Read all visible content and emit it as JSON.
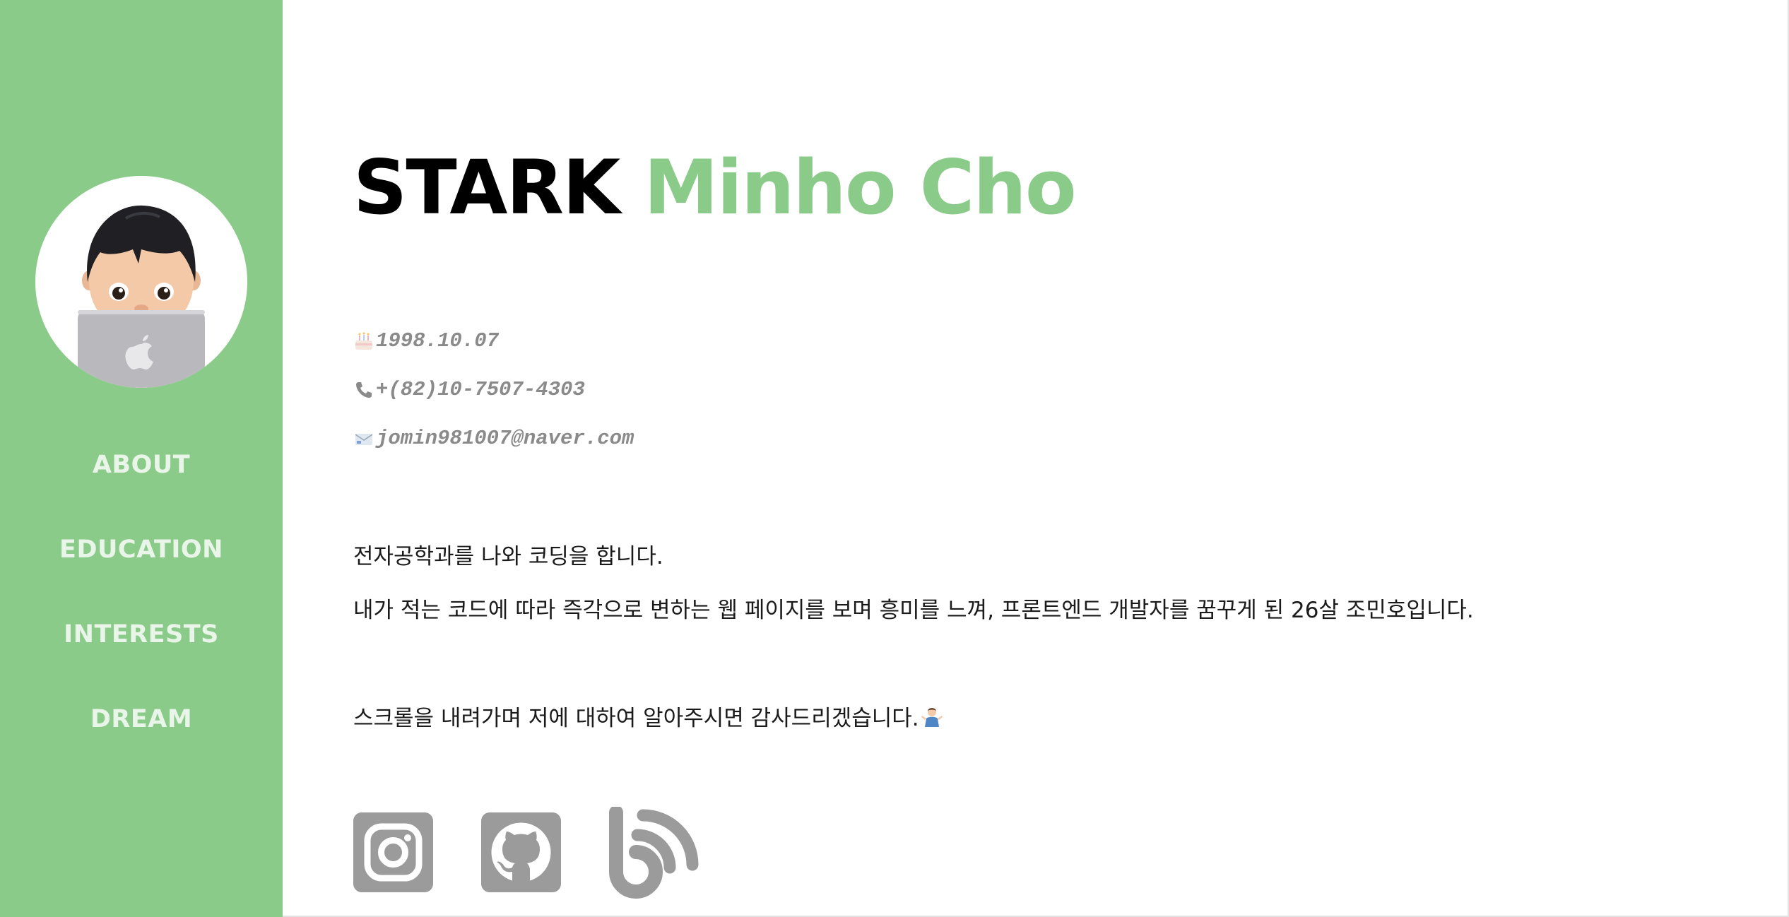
{
  "sidebar": {
    "nav": [
      {
        "label": "ABOUT"
      },
      {
        "label": "EDUCATION"
      },
      {
        "label": "INTERESTS"
      },
      {
        "label": "DREAM"
      }
    ]
  },
  "header": {
    "title_prefix": "STARK",
    "title_name": "Minho Cho"
  },
  "contact": {
    "birthday": "1998.10.07",
    "phone": "+(82)10-7507-4303",
    "email": "jomin981007@naver.com"
  },
  "intro": {
    "line1": "전자공학과를 나와 코딩을 합니다.",
    "line2": "내가 적는 코드에 따라 즉각으로 변하는 웹 페이지를 보며 흥미를 느껴, 프론트엔드 개발자를 꿈꾸게 된 26살 조민호입니다.",
    "line3": "스크롤을 내려가며 저에 대하여 알아주시면 감사드리겠습니다."
  },
  "colors": {
    "accent": "#8bcb89",
    "icon_gray": "#9b9b9b"
  },
  "icons": {
    "birthday": "cake-icon",
    "phone": "phone-icon",
    "email": "envelope-icon",
    "shrug": "person-shrugging-icon",
    "social": [
      "instagram-icon",
      "github-icon",
      "blog-icon"
    ]
  }
}
